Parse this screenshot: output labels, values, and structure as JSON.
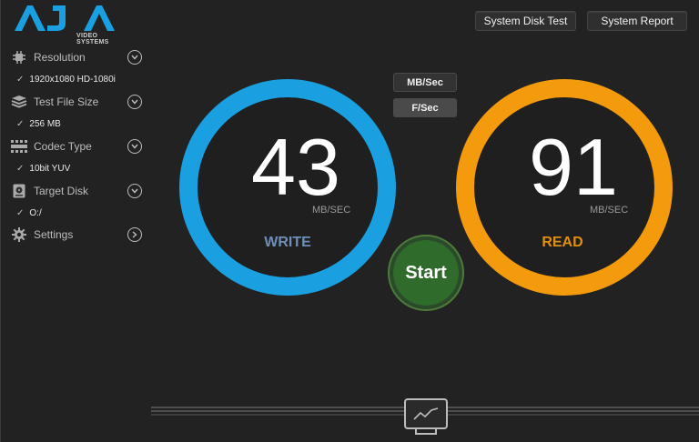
{
  "logo": {
    "text": "AJA",
    "subtitle": "VIDEO SYSTEMS"
  },
  "toolbar": {
    "system_disk_test": "System Disk Test",
    "system_report": "System Report"
  },
  "sidebar": {
    "items": [
      {
        "label": "Resolution",
        "value": "1920x1080 HD-1080i",
        "icon": "resolution-icon",
        "chevron": "chevron-down-icon"
      },
      {
        "label": "Test File Size",
        "value": "256 MB",
        "icon": "file-stack-icon",
        "chevron": "chevron-down-icon"
      },
      {
        "label": "Codec Type",
        "value": "10bit YUV",
        "icon": "codec-grid-icon",
        "chevron": "chevron-down-icon"
      },
      {
        "label": "Target Disk",
        "value": "O:/",
        "icon": "disk-icon",
        "chevron": "chevron-down-icon"
      },
      {
        "label": "Settings",
        "icon": "gear-icon",
        "chevron": "chevron-right-icon"
      }
    ],
    "check_glyph": "✓"
  },
  "units": {
    "mb_sec": "MB/Sec",
    "f_sec": "F/Sec"
  },
  "write": {
    "value": "43",
    "unit": "MB/SEC",
    "label": "WRITE",
    "color": "#1a9fe0",
    "label_color": "#6f8fb8"
  },
  "read": {
    "value": "91",
    "unit": "MB/SEC",
    "label": "READ",
    "color": "#f39a0d",
    "label_color": "#e0900f"
  },
  "start": {
    "label": "Start",
    "color": "#2f6b2a"
  },
  "colors": {
    "background": "#222222",
    "gauge_inner": "#201f1f"
  }
}
